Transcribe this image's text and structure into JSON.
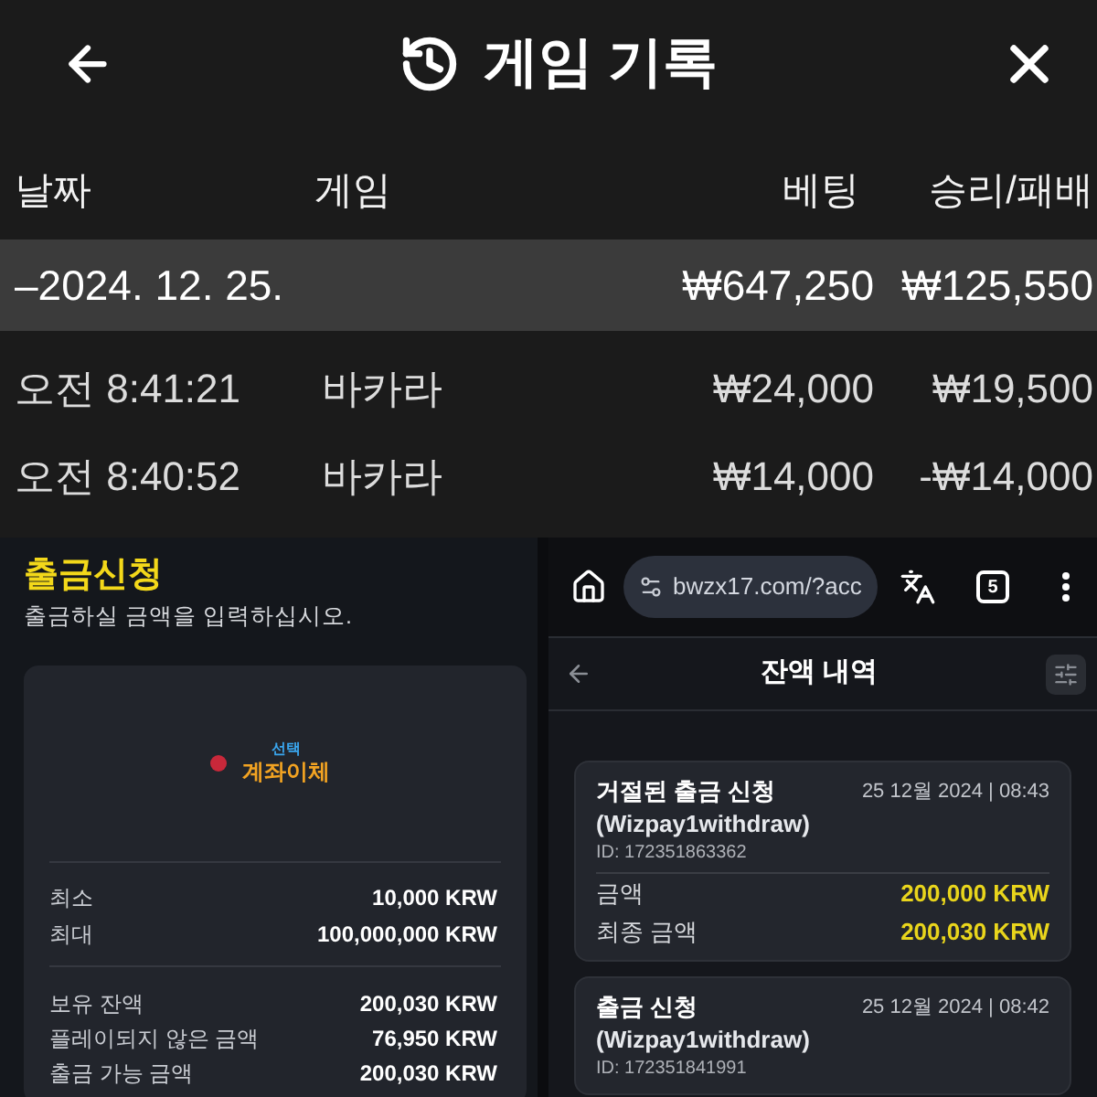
{
  "game_history": {
    "title": "게임 기록",
    "columns": [
      "날짜",
      "게임",
      "베팅",
      "승리/패배"
    ],
    "rows": [
      {
        "kind": "group",
        "date": "–2024. 12. 25.",
        "bet": "₩647,250",
        "result": "₩125,550"
      },
      {
        "kind": "entry",
        "date": "오전 8:41:21",
        "game": "바카라",
        "bet": "₩24,000",
        "result": "₩19,500"
      },
      {
        "kind": "entry",
        "date": "오전 8:40:52",
        "game": "바카라",
        "bet": "₩14,000",
        "result": "-₩14,000"
      }
    ]
  },
  "withdrawal": {
    "title": "출금신청",
    "subtitle": "출금하실 금액을 입력하십시오.",
    "method": {
      "caption": "선택",
      "name": "계좌이체"
    },
    "limits": [
      {
        "label": "최소",
        "value": "10,000 KRW"
      },
      {
        "label": "최대",
        "value": "100,000,000 KRW"
      }
    ],
    "balances": [
      {
        "label": "보유 잔액",
        "value": "200,030 KRW"
      },
      {
        "label": "플레이되지 않은 금액",
        "value": "76,950 KRW"
      },
      {
        "label": "출금 가능 금액",
        "value": "200,030 KRW"
      }
    ]
  },
  "browser": {
    "url": "bwzx17.com/?acc",
    "tab_count": "5"
  },
  "balance_history": {
    "title": "잔액 내역",
    "entries": [
      {
        "title": "거절된 출금 신청",
        "date": "25 12월 2024 | 08:43",
        "method": "(Wizpay1withdraw)",
        "id": "ID: 172351863362",
        "amounts": [
          {
            "label": "금액",
            "value": "200,000 KRW"
          },
          {
            "label": "최종 금액",
            "value": "200,030 KRW"
          }
        ]
      },
      {
        "title": "출금 신청",
        "date": "25 12월 2024 | 08:42",
        "method": "(Wizpay1withdraw)",
        "id": "ID: 172351841991"
      }
    ]
  }
}
